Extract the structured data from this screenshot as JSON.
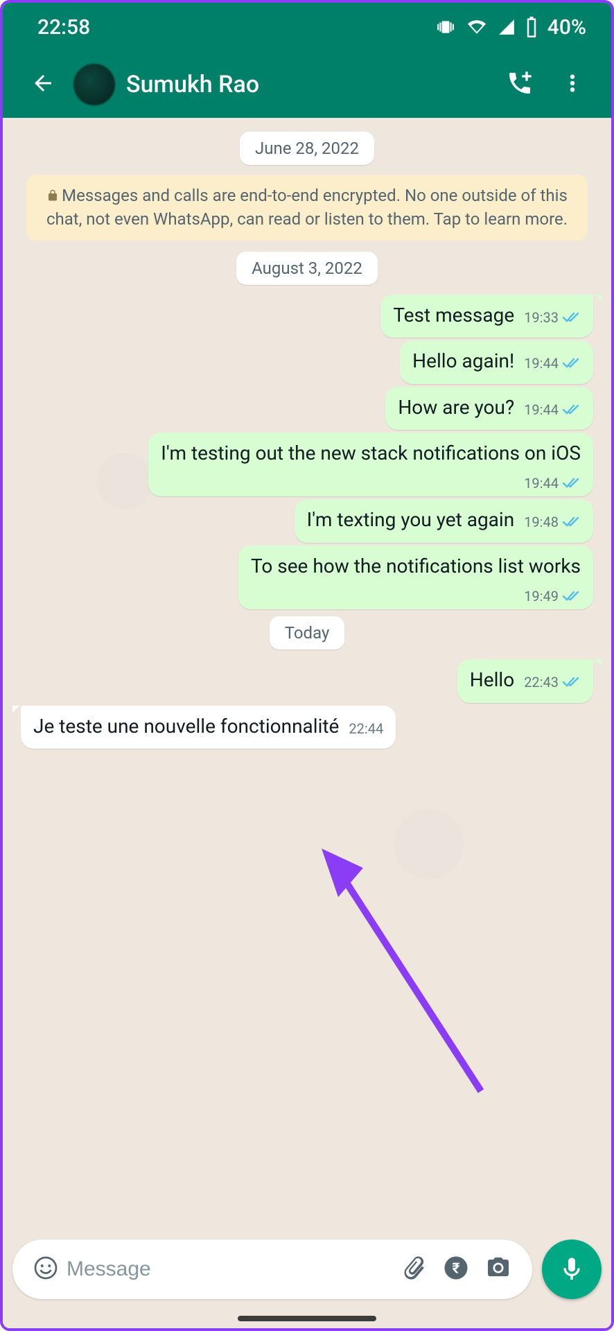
{
  "status": {
    "time": "22:58",
    "battery": "40%"
  },
  "header": {
    "contact_name": "Sumukh Rao"
  },
  "dates": {
    "d1": "June 28, 2022",
    "d2": "August 3, 2022",
    "d3": "Today"
  },
  "encryption_notice": "Messages and calls are end-to-end encrypted. No one outside of this chat, not even WhatsApp, can read or listen to them. Tap to learn more.",
  "messages": {
    "m1": {
      "text": "Test message",
      "time": "19:33"
    },
    "m2": {
      "text": "Hello again!",
      "time": "19:44"
    },
    "m3": {
      "text": "How are you?",
      "time": "19:44"
    },
    "m4": {
      "text": "I'm testing out the new stack notifications on iOS",
      "time": "19:44"
    },
    "m5": {
      "text": "I'm texting you yet again",
      "time": "19:48"
    },
    "m6": {
      "text": "To see how the notifications list works",
      "time": "19:49"
    },
    "m7": {
      "text": "Hello",
      "time": "22:43"
    },
    "m8": {
      "text": "Je teste une nouvelle fonctionnalité",
      "time": "22:44"
    }
  },
  "input": {
    "placeholder": "Message"
  }
}
